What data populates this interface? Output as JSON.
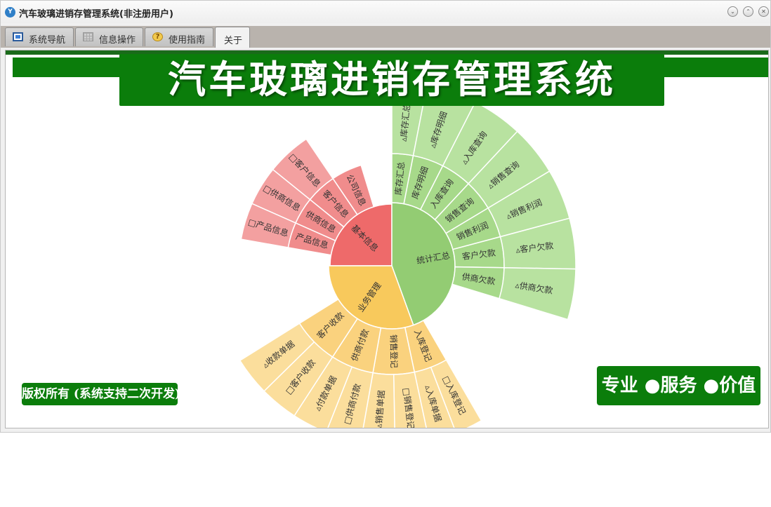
{
  "window": {
    "title": "汽车玻璃进销存管理系统(非注册用户)",
    "buttons": [
      "⌄",
      "⌃",
      "✕"
    ]
  },
  "tabs": [
    {
      "label": "系统导航",
      "icon": "monitor-icon"
    },
    {
      "label": "信息操作",
      "icon": "grid-icon"
    },
    {
      "label": "使用指南",
      "icon": "help-icon"
    },
    {
      "label": "关于",
      "icon": ""
    }
  ],
  "active_tab": "关于",
  "banner": {
    "title": "汽车玻璃进销存管理系统"
  },
  "footer": {
    "copyright": "版权所有 (系统支持二次开发)",
    "slogan": "专业 ●服务 ●价值"
  },
  "colors": {
    "brand_green": "#0b7d0b",
    "red_dark": "#ee6a6a",
    "red_mid": "#f08c8c",
    "red_light": "#f3a0a0",
    "green_dark": "#93cc73",
    "green_mid": "#a7d98a",
    "green_light": "#b8e2a0",
    "yellow_dark": "#f8c95c",
    "yellow_mid": "#fad27e",
    "yellow_light": "#fbde9c"
  },
  "sunburst": {
    "categories": [
      {
        "name": "基本信息",
        "children": [
          {
            "name": "公司信息",
            "children": []
          },
          {
            "name": "客户信息",
            "children": [
              "客户信息"
            ]
          },
          {
            "name": "供商信息",
            "children": [
              "供商信息"
            ]
          },
          {
            "name": "产品信息",
            "children": [
              "产品信息"
            ]
          }
        ]
      },
      {
        "name": "统计汇总",
        "children": [
          {
            "name": "库存汇总",
            "children": [
              "库存汇总"
            ]
          },
          {
            "name": "库存明细",
            "children": [
              "库存明细"
            ]
          },
          {
            "name": "入库查询",
            "children": [
              "入库查询"
            ]
          },
          {
            "name": "销售查询",
            "children": [
              "销售查询"
            ]
          },
          {
            "name": "销售利润",
            "children": [
              "销售利润"
            ]
          },
          {
            "name": "客户欠款",
            "children": [
              "客户欠款"
            ]
          },
          {
            "name": "供商欠款",
            "children": [
              "供商欠款"
            ]
          }
        ]
      },
      {
        "name": "业务管理",
        "children": [
          {
            "name": "入库登记",
            "children": [
              "入库登记",
              "入库单据"
            ]
          },
          {
            "name": "销售登记",
            "children": [
              "销售登记",
              "销售单据"
            ]
          },
          {
            "name": "供商付款",
            "children": [
              "供商付款",
              "付款单据"
            ]
          },
          {
            "name": "客户收款",
            "children": [
              "客户收款",
              "收款单据"
            ]
          }
        ]
      }
    ]
  }
}
